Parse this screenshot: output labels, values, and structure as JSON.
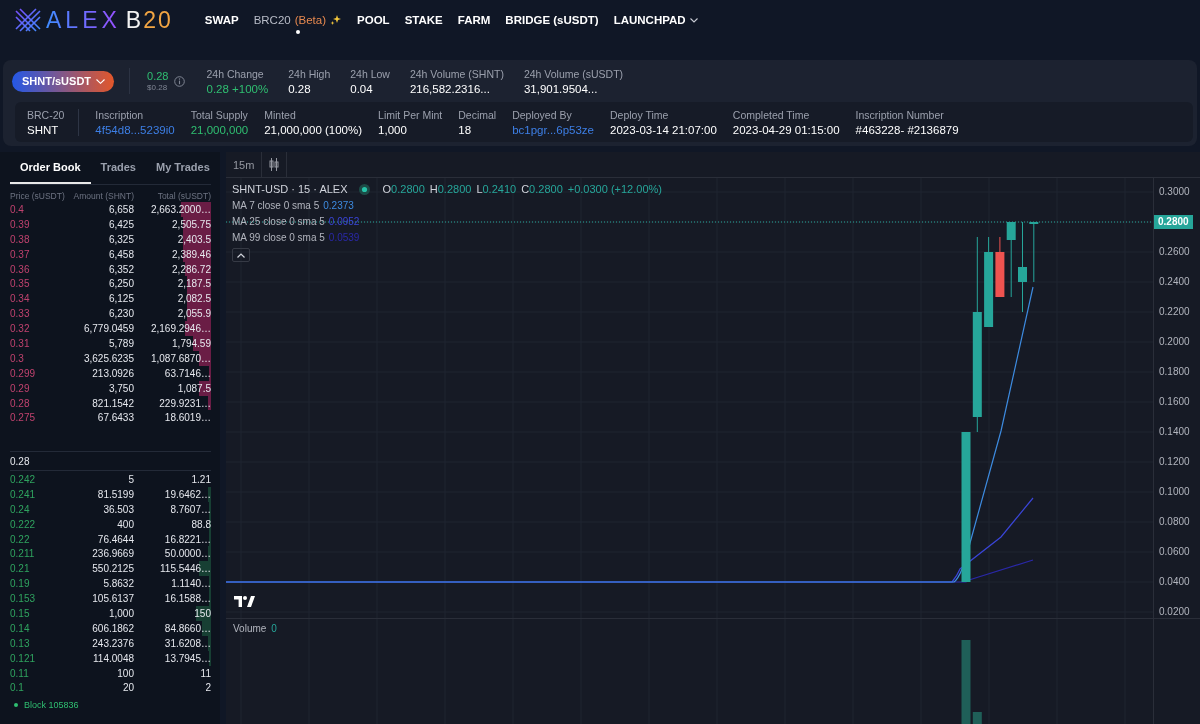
{
  "nav": {
    "logo": {
      "name": "ALEX",
      "suffix": "B20"
    },
    "items": [
      {
        "label": "SWAP",
        "selected": false
      },
      {
        "label": "BRC20",
        "badge": "(Beta)",
        "sparkle": true,
        "selected": true
      },
      {
        "label": "POOL",
        "selected": false
      },
      {
        "label": "STAKE",
        "selected": false
      },
      {
        "label": "FARM",
        "selected": false
      },
      {
        "label": "BRIDGE (sUSDT)",
        "selected": false
      },
      {
        "label": "LAUNCHPAD",
        "dropdown": true,
        "selected": false
      }
    ]
  },
  "market": {
    "pair": "SHNT/sUSDT",
    "price": "0.28",
    "price_usd": "$0.28",
    "stats": [
      {
        "label": "24h Change",
        "value": "0.28 +100%",
        "kind": "positive"
      },
      {
        "label": "24h High",
        "value": "0.28",
        "kind": "plain"
      },
      {
        "label": "24h Low",
        "value": "0.04",
        "kind": "plain"
      },
      {
        "label": "24h Volume (SHNT)",
        "value": "216,582.2316...",
        "kind": "plain"
      },
      {
        "label": "24h Volume (sUSDT)",
        "value": "31,901.9504...",
        "kind": "plain"
      }
    ]
  },
  "token": {
    "fields": [
      {
        "label": "BRC-20",
        "value": "SHNT",
        "kind": "plain"
      },
      {
        "label": "Inscription",
        "value": "4f54d8...5239i0",
        "kind": "link"
      },
      {
        "label": "Total Supply",
        "value": "21,000,000",
        "kind": "positive"
      },
      {
        "label": "Minted",
        "value": "21,000,000 (100%)",
        "kind": "plain"
      },
      {
        "label": "Limit Per Mint",
        "value": "1,000",
        "kind": "plain"
      },
      {
        "label": "Decimal",
        "value": "18",
        "kind": "plain"
      },
      {
        "label": "Deployed By",
        "value": "bc1pgr...6p53ze",
        "kind": "link"
      },
      {
        "label": "Deploy Time",
        "value": "2023-03-14 21:07:00",
        "kind": "plain"
      },
      {
        "label": "Completed Time",
        "value": "2023-04-29 01:15:00",
        "kind": "plain"
      },
      {
        "label": "Inscription Number",
        "value": "#463228- #2136879",
        "kind": "plain"
      }
    ]
  },
  "order_book": {
    "tabs": [
      {
        "label": "Order Book",
        "selected": true
      },
      {
        "label": "Trades",
        "selected": false
      },
      {
        "label": "My Trades",
        "selected": false
      }
    ],
    "columns": [
      "Price (sUSDT)",
      "Amount (SHNT)",
      "Total (sUSDT)"
    ],
    "asks": [
      {
        "price": "0.4",
        "amount": "6,658",
        "total": "2,663.2000…",
        "level": 0.15
      },
      {
        "price": "0.39",
        "amount": "6,425",
        "total": "2,505.75",
        "level": 0.14
      },
      {
        "price": "0.38",
        "amount": "6,325",
        "total": "2,403.5",
        "level": 0.14
      },
      {
        "price": "0.37",
        "amount": "6,458",
        "total": "2,389.46",
        "level": 0.14
      },
      {
        "price": "0.36",
        "amount": "6,352",
        "total": "2,286.72",
        "level": 0.13
      },
      {
        "price": "0.35",
        "amount": "6,250",
        "total": "2,187.5",
        "level": 0.12
      },
      {
        "price": "0.34",
        "amount": "6,125",
        "total": "2,082.5",
        "level": 0.12
      },
      {
        "price": "0.33",
        "amount": "6,230",
        "total": "2,055.9",
        "level": 0.12
      },
      {
        "price": "0.32",
        "amount": "6,779.0459",
        "total": "2,169.2946…",
        "level": 0.13
      },
      {
        "price": "0.31",
        "amount": "5,789",
        "total": "1,794.59",
        "level": 0.09
      },
      {
        "price": "0.3",
        "amount": "3,625.6235",
        "total": "1,087.6870…",
        "level": 0.06
      },
      {
        "price": "0.299",
        "amount": "213.0926",
        "total": "63.7146…",
        "level": 0.01
      },
      {
        "price": "0.29",
        "amount": "3,750",
        "total": "1,087.5",
        "level": 0.06
      },
      {
        "price": "0.28",
        "amount": "821.1542",
        "total": "229.9231…",
        "level": 0.015
      },
      {
        "price": "0.275",
        "amount": "67.6433",
        "total": "18.6019…"
      }
    ],
    "mid_price": "0.28",
    "bids": [
      {
        "price": "0.242",
        "amount": "5",
        "total": "1.21"
      },
      {
        "price": "0.241",
        "amount": "81.5199",
        "total": "19.6462…",
        "level": 0.015
      },
      {
        "price": "0.24",
        "amount": "36.503",
        "total": "8.7607…",
        "level": 0.01
      },
      {
        "price": "0.222",
        "amount": "400",
        "total": "88.8",
        "level": 0.01
      },
      {
        "price": "0.22",
        "amount": "76.4644",
        "total": "16.8221…",
        "level": 0.01
      },
      {
        "price": "0.211",
        "amount": "236.9669",
        "total": "50.0000…",
        "level": 0.015
      },
      {
        "price": "0.21",
        "amount": "550.2125",
        "total": "115.5446…",
        "level": 0.06
      },
      {
        "price": "0.19",
        "amount": "5.8632",
        "total": "1.1140…",
        "level": 0.01
      },
      {
        "price": "0.153",
        "amount": "105.6137",
        "total": "16.1588…",
        "level": 0.01
      },
      {
        "price": "0.15",
        "amount": "1,000",
        "total": "150",
        "level": 0.075
      },
      {
        "price": "0.14",
        "amount": "606.1862",
        "total": "84.8660…",
        "level": 0.045
      },
      {
        "price": "0.13",
        "amount": "243.2376",
        "total": "31.6208…",
        "level": 0.013
      },
      {
        "price": "0.121",
        "amount": "114.0048",
        "total": "13.7945…",
        "level": 0.01
      },
      {
        "price": "0.11",
        "amount": "100",
        "total": "11"
      },
      {
        "price": "0.1",
        "amount": "20",
        "total": "2"
      }
    ],
    "status": "Block 105836"
  },
  "chart": {
    "interval": "15m",
    "symbol": "SHNT-USD · 15 · ALEX",
    "ohlc": [
      {
        "label": "O",
        "value": "0.2800"
      },
      {
        "label": "H",
        "value": "0.2800"
      },
      {
        "label": "L",
        "value": "0.2410"
      },
      {
        "label": "C",
        "value": "0.2800"
      }
    ],
    "change": "+0.0300 (+12.00%)",
    "indicators": [
      {
        "name": "MA 7 close 0 sma 5",
        "value": "0.2373",
        "color": "#3d8be0"
      },
      {
        "name": "MA 25 close 0 sma 5",
        "value": "0.0952",
        "color": "#3a45d8"
      },
      {
        "name": "MA 99 close 0 sma 5",
        "value": "0.0539",
        "color": "#2a28a8"
      }
    ],
    "price_axis": [
      {
        "text": "0.3000",
        "kind": "tick"
      },
      {
        "text": "0.2800",
        "kind": "last"
      },
      {
        "text": "0.2600",
        "kind": "tick"
      },
      {
        "text": "0.2400",
        "kind": "tick"
      },
      {
        "text": "0.2200",
        "kind": "tick"
      },
      {
        "text": "0.2000",
        "kind": "tick"
      },
      {
        "text": "0.1800",
        "kind": "tick"
      },
      {
        "text": "0.1600",
        "kind": "tick"
      },
      {
        "text": "0.1400",
        "kind": "tick"
      },
      {
        "text": "0.1200",
        "kind": "tick"
      },
      {
        "text": "0.1000",
        "kind": "tick"
      },
      {
        "text": "0.0800",
        "kind": "tick"
      },
      {
        "text": "0.0600",
        "kind": "tick"
      },
      {
        "text": "0.0400",
        "kind": "tick"
      },
      {
        "text": "0.0200",
        "kind": "tick"
      }
    ],
    "volume": {
      "label": "Volume",
      "value": "0"
    }
  }
}
